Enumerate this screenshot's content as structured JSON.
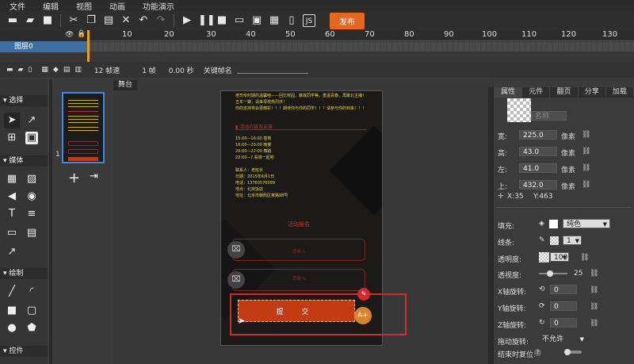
{
  "menu": [
    "文件",
    "编辑",
    "视图",
    "动画",
    "功能演示"
  ],
  "toolbar": {
    "publish_label": "发布"
  },
  "timeline": {
    "ticks": [
      "10",
      "20",
      "30",
      "40",
      "50",
      "60",
      "70",
      "80",
      "90",
      "100",
      "110",
      "120",
      "130"
    ],
    "layer_name": "图层0",
    "fps": "12 帧速",
    "frame": "1 帧",
    "time": "0.00 秒",
    "keyframe_label": "关键帧名"
  },
  "tool_sections": {
    "select": "选择",
    "media": "媒体",
    "draw": "绘制",
    "control": "控件"
  },
  "pages": {
    "page_number": "1"
  },
  "stage": {
    "tab_label": "舞台",
    "lines_top": [
      "老司专时期的温馨吧——回忆校园，聚故同学等，重温青春，再聚北主播！",
      "五年一聚，请来母校热烈庆！",
      "你的支持将会更精彩！！！期待你与你的同学！！！请参与你的到来！！！"
    ],
    "section_title": "活动内容及安排",
    "schedule": [
      "15:00—16:00 签到",
      "16:00—20:00 晚宴",
      "20:00—22:00 舞蹈",
      "22:00—?   看谁一起吧"
    ],
    "contact": [
      "联系人：老班长",
      "日期：2015年6月1日",
      "电话：13760576099",
      "地点：北京饭店",
      "地址：北京市朝阳区某路88号"
    ],
    "signup_title": "活动报名",
    "input1_placeholder": "请输入",
    "input2_placeholder": "请输入",
    "submit_label": "提 交"
  },
  "props": {
    "tabs": [
      "属性",
      "元件",
      "翻页",
      "分享",
      "加载"
    ],
    "name_placeholder": "名称",
    "width_label": "宽:",
    "width": "225.0",
    "height_label": "高:",
    "height": "43.0",
    "left_label": "左:",
    "left": "41.0",
    "top_label": "上:",
    "top": "432.0",
    "unit": "像素",
    "coord_x": "X:35",
    "coord_y": "Y:463",
    "fill_label": "填充:",
    "fill_mode": "纯色",
    "stroke_label": "线条:",
    "stroke_width": "1",
    "opacity_label": "透明度:",
    "opacity": "100",
    "perspective_label": "透视度:",
    "perspective": "25",
    "xrot_label": "X轴旋转:",
    "xrot": "0",
    "yrot_label": "Y轴旋转:",
    "yrot": "0",
    "zrot_label": "Z轴旋转:",
    "zrot": "0",
    "drag_rotate_label": "拖动旋转:",
    "drag_rotate": "不允许",
    "reset_label": "结束时复位:"
  }
}
